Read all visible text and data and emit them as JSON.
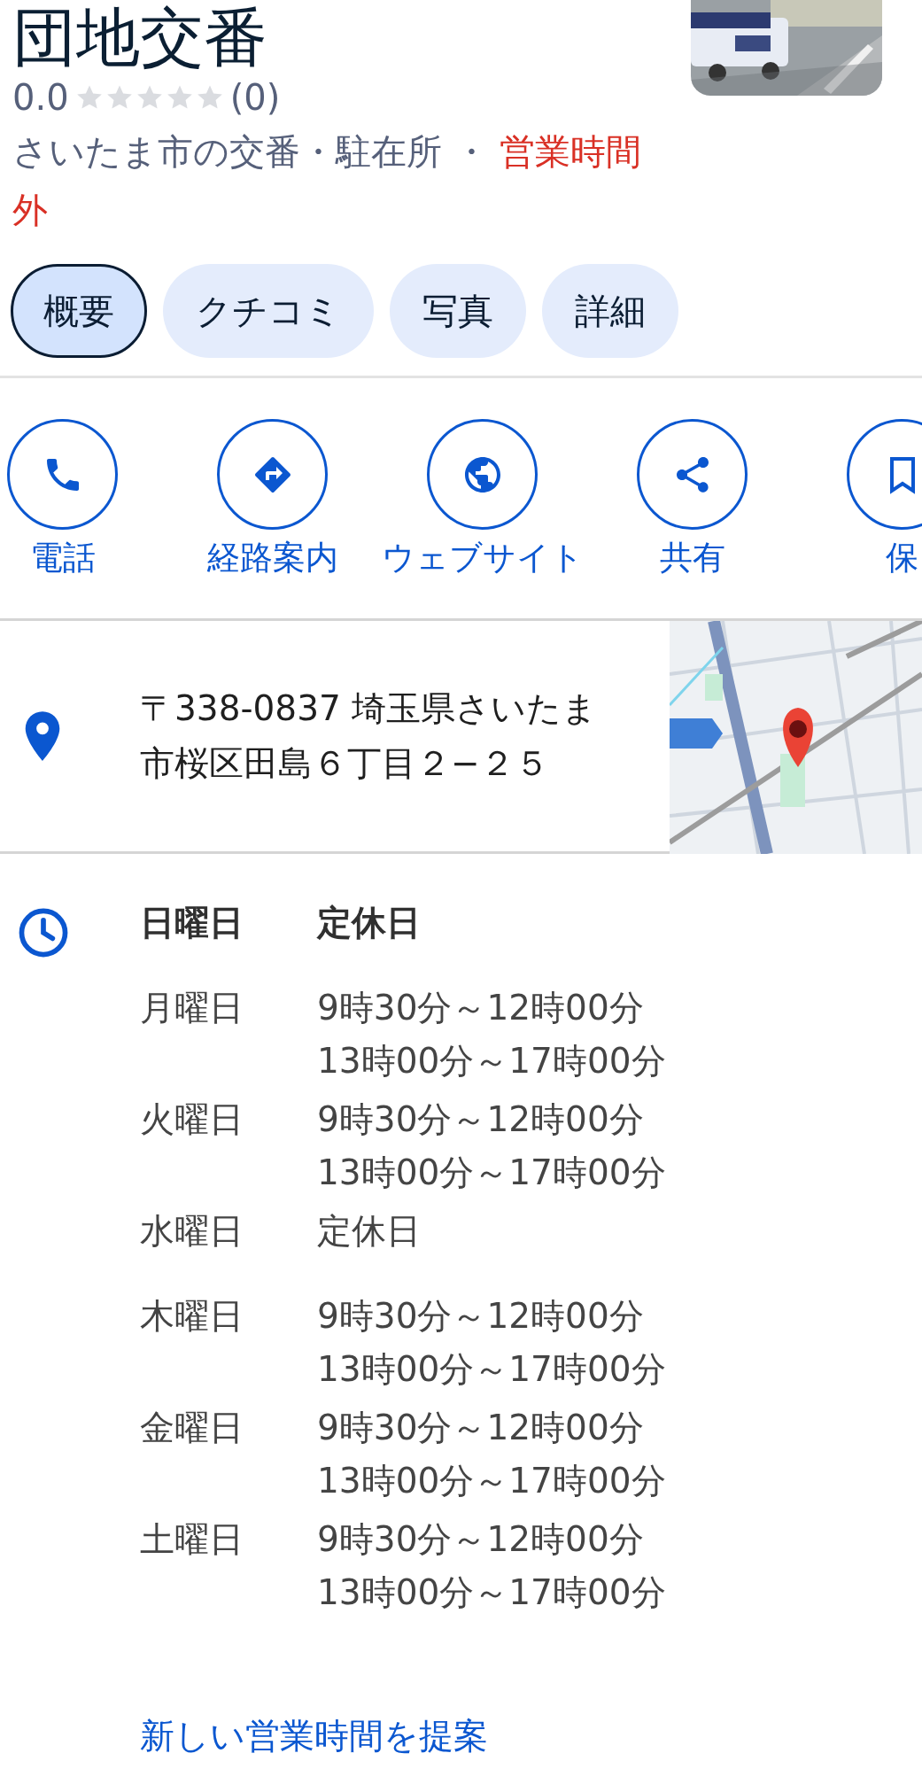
{
  "place": {
    "title": "団地交番",
    "rating": "0.0",
    "stars": 0,
    "review_count": "(0)",
    "category": "さいたま市の交番・駐在所",
    "separator": "・",
    "open_status": {
      "text": "営業時間外",
      "open": false
    }
  },
  "tabs": [
    {
      "label": "概要",
      "selected": true
    },
    {
      "label": "クチコミ",
      "selected": false
    },
    {
      "label": "写真",
      "selected": false
    },
    {
      "label": "詳細",
      "selected": false
    }
  ],
  "actions": [
    {
      "kind": "phone",
      "label": "電話"
    },
    {
      "kind": "directions",
      "label": "経路案内"
    },
    {
      "kind": "website",
      "label": "ウェブサイト"
    },
    {
      "kind": "share",
      "label": "共有"
    },
    {
      "kind": "save",
      "label": "保"
    }
  ],
  "address": {
    "text": "〒338-0837 埼玉県さいたま市桜区田島６丁目２−２５"
  },
  "hours": [
    {
      "day": "日曜日",
      "today": true,
      "times": [
        "定休日"
      ]
    },
    {
      "day": "月曜日",
      "today": false,
      "times": [
        "9時30分～12時00分",
        "13時00分～17時00分"
      ]
    },
    {
      "day": "火曜日",
      "today": false,
      "times": [
        "9時30分～12時00分",
        "13時00分～17時00分"
      ]
    },
    {
      "day": "水曜日",
      "today": false,
      "times": [
        "定休日"
      ]
    },
    {
      "day": "木曜日",
      "today": false,
      "times": [
        "9時30分～12時00分",
        "13時00分～17時00分"
      ]
    },
    {
      "day": "金曜日",
      "today": false,
      "times": [
        "9時30分～12時00分",
        "13時00分～17時00分"
      ]
    },
    {
      "day": "土曜日",
      "today": false,
      "times": [
        "9時30分～12時00分",
        "13時00分～17時00分"
      ]
    }
  ],
  "suggest_link": "新しい営業時間を提案"
}
